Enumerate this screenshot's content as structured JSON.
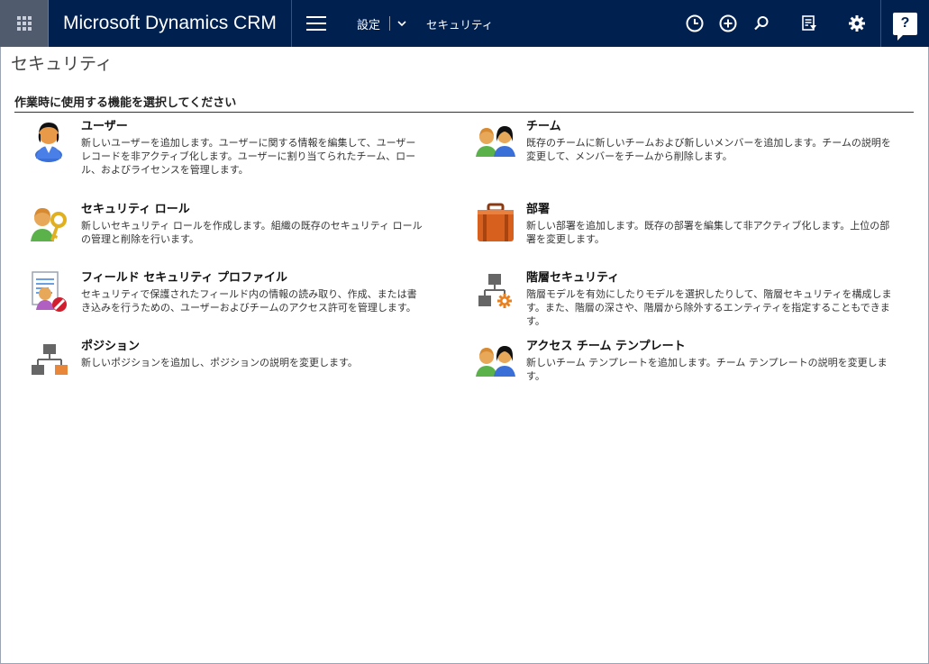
{
  "header": {
    "brand": "Microsoft Dynamics CRM",
    "area": "設定",
    "sub_area": "セキュリティ",
    "icons": [
      "waffle-icon",
      "hamburger-icon",
      "chevron-down-icon",
      "recent-icon",
      "create-icon",
      "search-icon",
      "advanced-find-icon",
      "gear-icon",
      "help-icon"
    ],
    "help_glyph": "?",
    "brand_color": "#002050"
  },
  "page": {
    "title": "セキュリティ",
    "section_heading": "作業時に使用する機能を選択してください"
  },
  "items": [
    {
      "title": "ユーザー",
      "description": "新しいユーザーを追加します。ユーザーに関する情報を編集して、ユーザー レコードを非アクティブ化します。ユーザーに割り当てられたチーム、ロール、およびライセンスを管理します。",
      "icon": "user-icon"
    },
    {
      "title": "チーム",
      "description": "既存のチームに新しいチームおよび新しいメンバーを追加します。チームの説明を変更して、メンバーをチームから削除します。",
      "icon": "team-icon"
    },
    {
      "title": "セキュリティ ロール",
      "description": "新しいセキュリティ ロールを作成します。組織の既存のセキュリティ ロールの管理と削除を行います。",
      "icon": "security-role-icon"
    },
    {
      "title": "部署",
      "description": "新しい部署を追加します。既存の部署を編集して非アクティブ化します。上位の部署を変更します。",
      "icon": "business-unit-icon"
    },
    {
      "title": "フィールド セキュリティ プロファイル",
      "description": "セキュリティで保護されたフィールド内の情報の読み取り、作成、または書き込みを行うための、ユーザーおよびチームのアクセス許可を管理します。",
      "icon": "field-security-icon"
    },
    {
      "title": "階層セキュリティ",
      "description": "階層モデルを有効にしたりモデルを選択したりして、階層セキュリティを構成します。また、階層の深さや、階層から除外するエンティティを指定することもできます。",
      "icon": "hierarchy-security-icon"
    },
    {
      "title": "ポジション",
      "description": "新しいポジションを追加し、ポジションの説明を変更します。",
      "icon": "position-icon"
    },
    {
      "title": "アクセス チーム テンプレート",
      "description": "新しいチーム テンプレートを追加します。チーム テンプレートの説明を変更します。",
      "icon": "access-team-template-icon"
    }
  ]
}
